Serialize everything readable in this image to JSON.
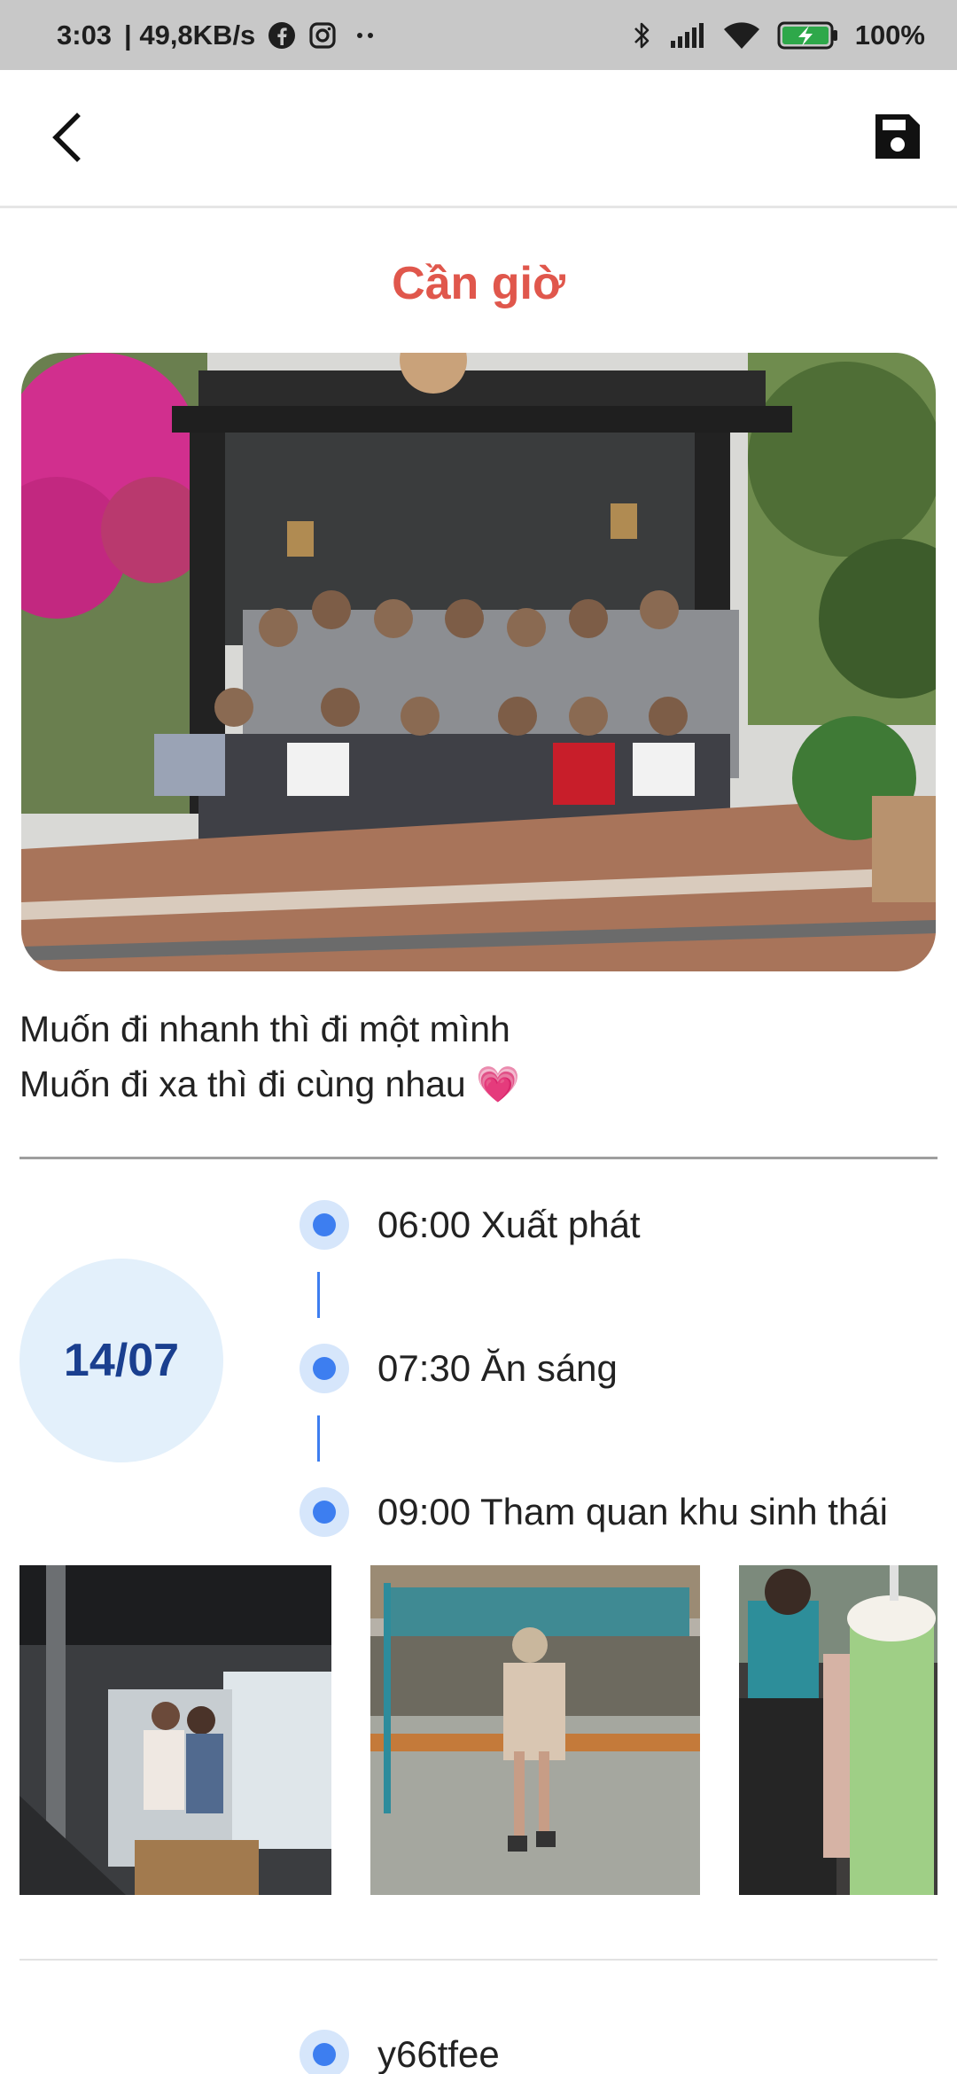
{
  "status_bar": {
    "time": "3:03",
    "network_speed": "| 49,8KB/s",
    "notification_icons": [
      "facebook-icon",
      "instagram-icon",
      "more-dots-icon"
    ],
    "system_icons": [
      "bluetooth-icon",
      "signal-icon",
      "wifi-icon",
      "battery-charging-icon"
    ],
    "battery": "100%",
    "bar_color": "#c8c8c8"
  },
  "app_bar": {
    "back_icon": "chevron-left-icon",
    "save_icon": "floppy-disk-icon"
  },
  "trip": {
    "title": "Cần giờ",
    "title_color": "#e0574c",
    "caption_line1": "Muốn đi nhanh thì đi một mình",
    "caption_line2": "Muốn đi xa thì đi cùng nhau",
    "caption_emoji": "💗"
  },
  "day": {
    "date": "14/07",
    "date_color": "#1a3f8f",
    "accent_color": "#3d7ef0",
    "events": [
      {
        "time": "06:00",
        "label": "Xuất phát"
      },
      {
        "time": "07:30",
        "label": "Ăn sáng"
      },
      {
        "time": "09:00",
        "label": "Tham quan khu sinh thái"
      }
    ]
  },
  "next_event": {
    "label": "y66tfee"
  }
}
